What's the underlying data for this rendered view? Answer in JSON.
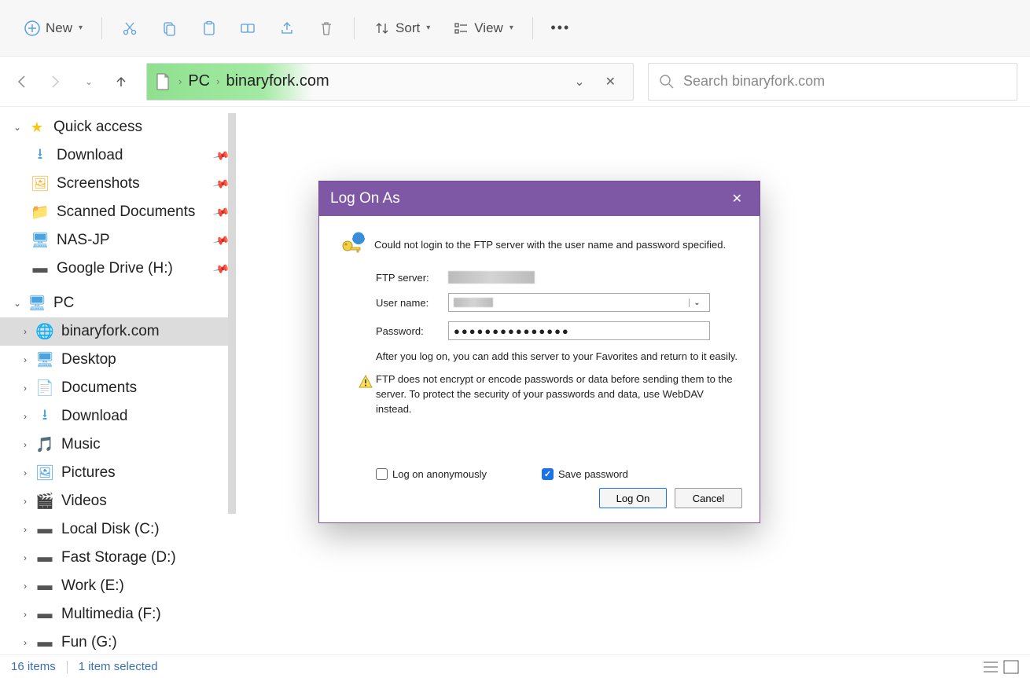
{
  "toolbar": {
    "new_label": "New",
    "sort_label": "Sort",
    "view_label": "View"
  },
  "breadcrumb": {
    "pc": "PC",
    "location": "binaryfork.com"
  },
  "search": {
    "placeholder": "Search binaryfork.com"
  },
  "sidebar": {
    "quick_access": "Quick access",
    "qa_items": [
      {
        "label": "Download"
      },
      {
        "label": "Screenshots"
      },
      {
        "label": "Scanned Documents"
      },
      {
        "label": "NAS-JP"
      },
      {
        "label": "Google Drive (H:)"
      }
    ],
    "pc_label": "PC",
    "pc_items": [
      {
        "label": "binaryfork.com"
      },
      {
        "label": "Desktop"
      },
      {
        "label": "Documents"
      },
      {
        "label": "Download"
      },
      {
        "label": "Music"
      },
      {
        "label": "Pictures"
      },
      {
        "label": "Videos"
      },
      {
        "label": "Local Disk (C:)"
      },
      {
        "label": "Fast Storage (D:)"
      },
      {
        "label": "Work (E:)"
      },
      {
        "label": "Multimedia (F:)"
      },
      {
        "label": "Fun (G:)"
      }
    ]
  },
  "status": {
    "items": "16 items",
    "selected": "1 item selected"
  },
  "dialog": {
    "title": "Log On As",
    "error": "Could not login to the FTP server with the user name and password specified.",
    "ftp_label": "FTP server:",
    "user_label": "User name:",
    "pwd_label": "Password:",
    "pwd_value": "●●●●●●●●●●●●●●●",
    "note": "After you log on, you can add this server to your Favorites and return to it easily.",
    "warn": "FTP does not encrypt or encode passwords or data before sending them to the server.  To protect the security of your passwords and data, use WebDAV instead.",
    "anon": "Log on anonymously",
    "save": "Save password",
    "logon_btn": "Log On",
    "cancel_btn": "Cancel"
  }
}
